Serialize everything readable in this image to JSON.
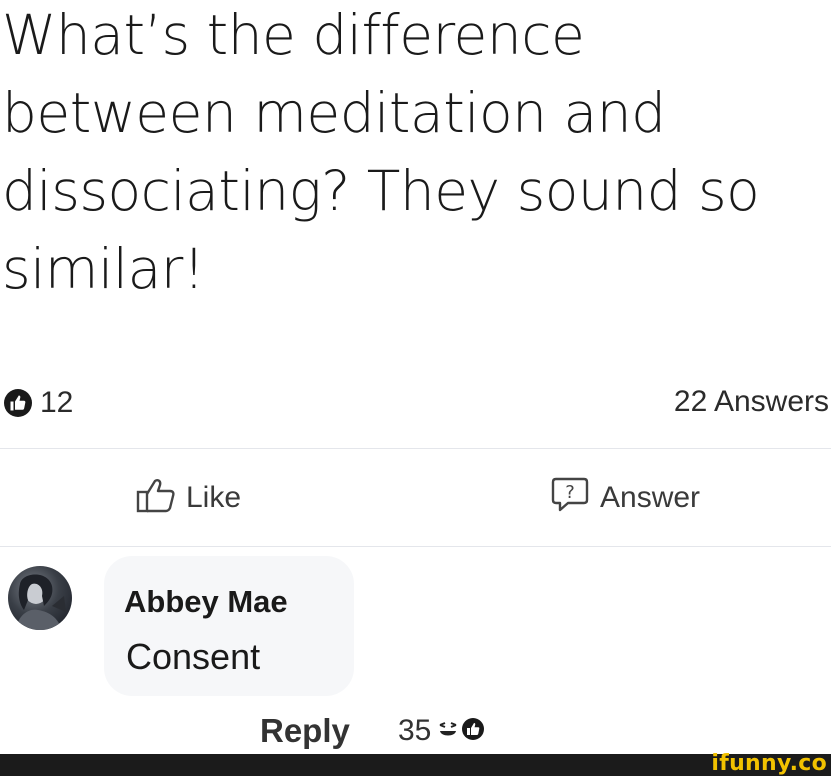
{
  "question": {
    "text": "What’s the difference between meditation and dissociating? They sound so similar!"
  },
  "stats": {
    "like_count": "12",
    "answers": "22 Answers"
  },
  "actions": {
    "like_label": "Like",
    "answer_label": "Answer"
  },
  "comment": {
    "author": "Abbey Mae",
    "text": "Consent",
    "reply_label": "Reply",
    "reaction_count": "35"
  },
  "footer": {
    "watermark": "ifunny.co"
  },
  "colors": {
    "watermark": "#f2c200",
    "footer_bar": "#1b1b1b"
  }
}
